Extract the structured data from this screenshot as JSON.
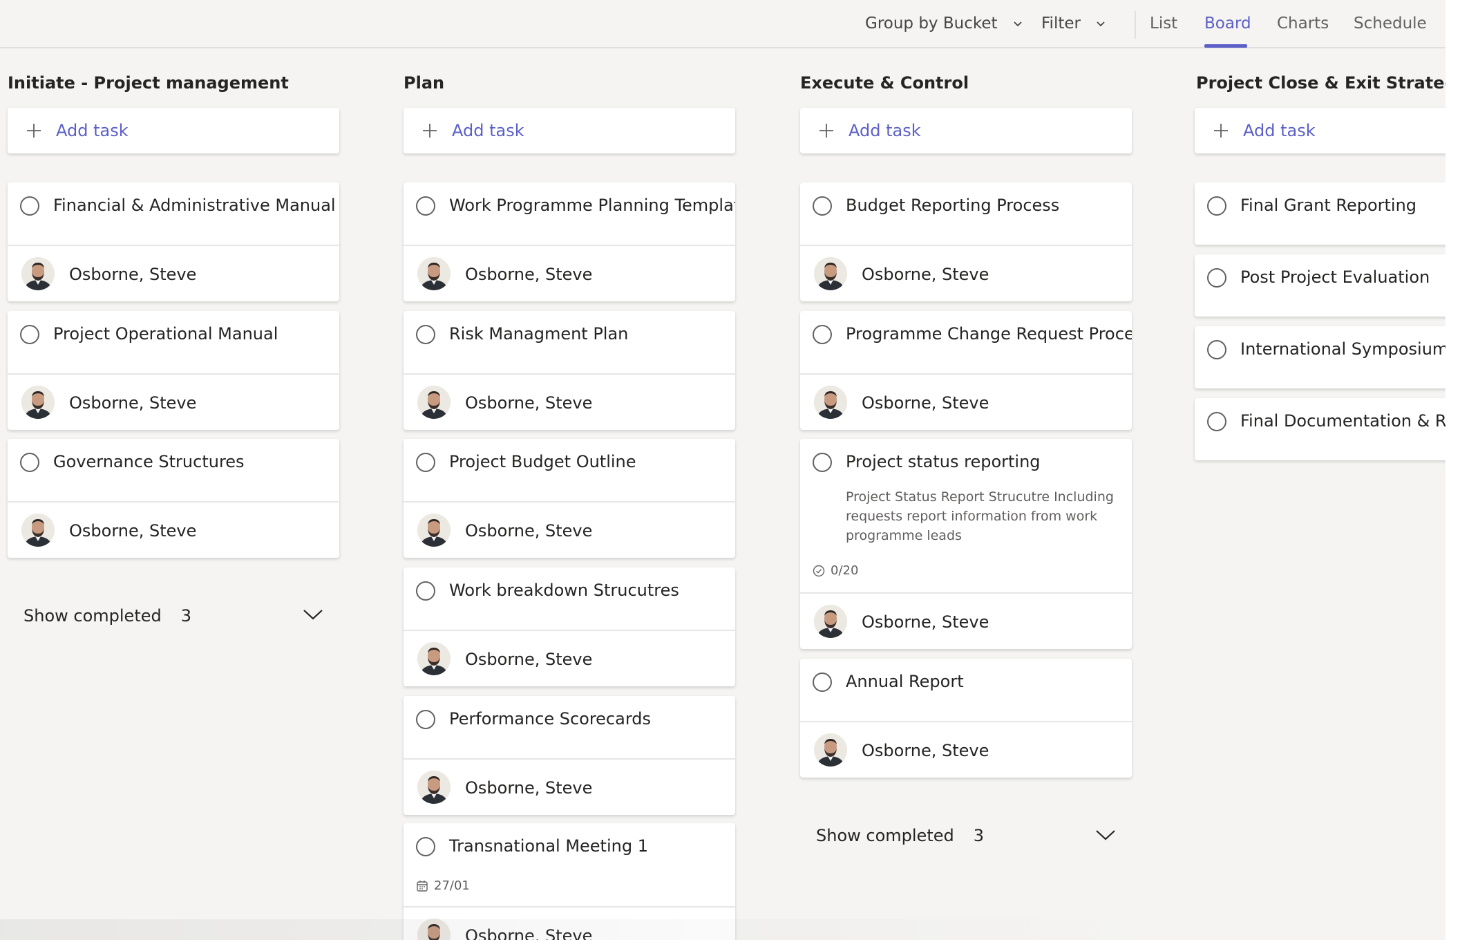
{
  "toolbar": {
    "group_by": "Group by Bucket",
    "filter": "Filter",
    "tabs": [
      {
        "label": "List"
      },
      {
        "label": "Board",
        "active": true
      },
      {
        "label": "Charts"
      },
      {
        "label": "Schedule"
      }
    ]
  },
  "accent_color": "#5b5fc7",
  "add_task_label": "Add task",
  "buckets": [
    {
      "title": "Initiate - Project management",
      "tasks": [
        {
          "title": "Financial & Administrative Manual",
          "assignee": "Osborne, Steve"
        },
        {
          "title": "Project Operational Manual",
          "assignee": "Osborne, Steve"
        },
        {
          "title": "Governance Structures",
          "assignee": "Osborne, Steve"
        }
      ],
      "show_completed": {
        "label": "Show completed",
        "count": "3"
      }
    },
    {
      "title": "Plan",
      "tasks": [
        {
          "title": "Work Programme Planning Templates",
          "assignee": "Osborne, Steve"
        },
        {
          "title": "Risk Managment Plan",
          "assignee": "Osborne, Steve"
        },
        {
          "title": "Project Budget Outline",
          "assignee": "Osborne, Steve"
        },
        {
          "title": "Work breakdown Strucutres",
          "assignee": "Osborne, Steve"
        },
        {
          "title": "Performance Scorecards",
          "assignee": "Osborne, Steve"
        },
        {
          "title": "Transnational Meeting 1",
          "due_date": "27/01",
          "assignee": "Osborne, Steve"
        }
      ]
    },
    {
      "title": "Execute & Control",
      "tasks": [
        {
          "title": "Budget Reporting Process",
          "assignee": "Osborne, Steve"
        },
        {
          "title": "Programme Change Request Process",
          "assignee": "Osborne, Steve"
        },
        {
          "title": "Project status reporting",
          "description": "Project Status Report Strucutre Including requests report information from work programme leads",
          "checklist": "0/20",
          "assignee": "Osborne, Steve"
        },
        {
          "title": "Annual Report",
          "assignee": "Osborne, Steve"
        }
      ],
      "show_completed": {
        "label": "Show completed",
        "count": "3"
      }
    },
    {
      "title": "Project Close & Exit Strategy",
      "tasks": [
        {
          "title": "Final Grant Reporting"
        },
        {
          "title": "Post Project Evaluation"
        },
        {
          "title": "International Symposium"
        },
        {
          "title": "Final Documentation & Reporting"
        }
      ]
    }
  ]
}
